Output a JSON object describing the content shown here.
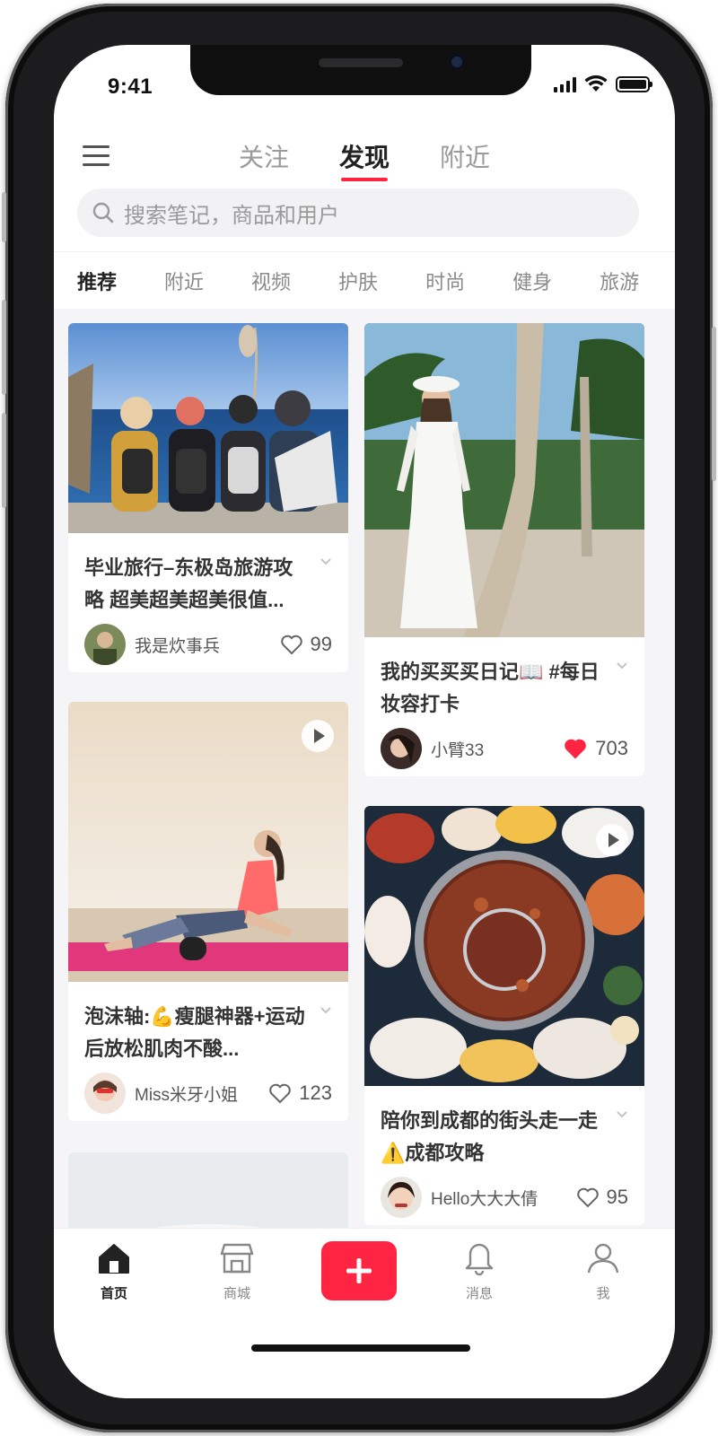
{
  "status": {
    "time": "9:41"
  },
  "top_nav": {
    "tabs": [
      "关注",
      "发现",
      "附近"
    ],
    "active_index": 1
  },
  "search": {
    "placeholder": "搜索笔记，商品和用户"
  },
  "categories": [
    "推荐",
    "附近",
    "视频",
    "护肤",
    "时尚",
    "健身",
    "旅游"
  ],
  "feed": {
    "cards": [
      {
        "title": "毕业旅行–东极岛旅游攻略 超美超美超美很值...",
        "author": "我是炊事兵",
        "likes": "99",
        "liked": false,
        "video": false
      },
      {
        "title": "我的买买买日记📖 #每日妆容打卡",
        "author": "小臂33",
        "likes": "703",
        "liked": true,
        "video": false
      },
      {
        "title": "泡沫轴:💪瘦腿神器+运动后放松肌肉不酸...",
        "author": "Miss米牙小姐",
        "likes": "123",
        "liked": false,
        "video": true
      },
      {
        "title": "陪你到成都的街头走一走⚠️成都攻略",
        "author": "Hello大大大倩",
        "likes": "95",
        "liked": false,
        "video": true
      }
    ]
  },
  "tabbar": {
    "tabs": [
      {
        "label": "首页",
        "icon": "home-icon",
        "active": true
      },
      {
        "label": "商城",
        "icon": "store-icon",
        "active": false
      },
      {
        "label": "消息",
        "icon": "bell-icon",
        "active": false
      },
      {
        "label": "我",
        "icon": "person-icon",
        "active": false
      }
    ],
    "publish_icon": "plus-icon"
  },
  "colors": {
    "accent": "#ff2442",
    "like_active": "#ff2442",
    "text_primary": "#333333",
    "text_secondary": "#9a9a9a"
  }
}
